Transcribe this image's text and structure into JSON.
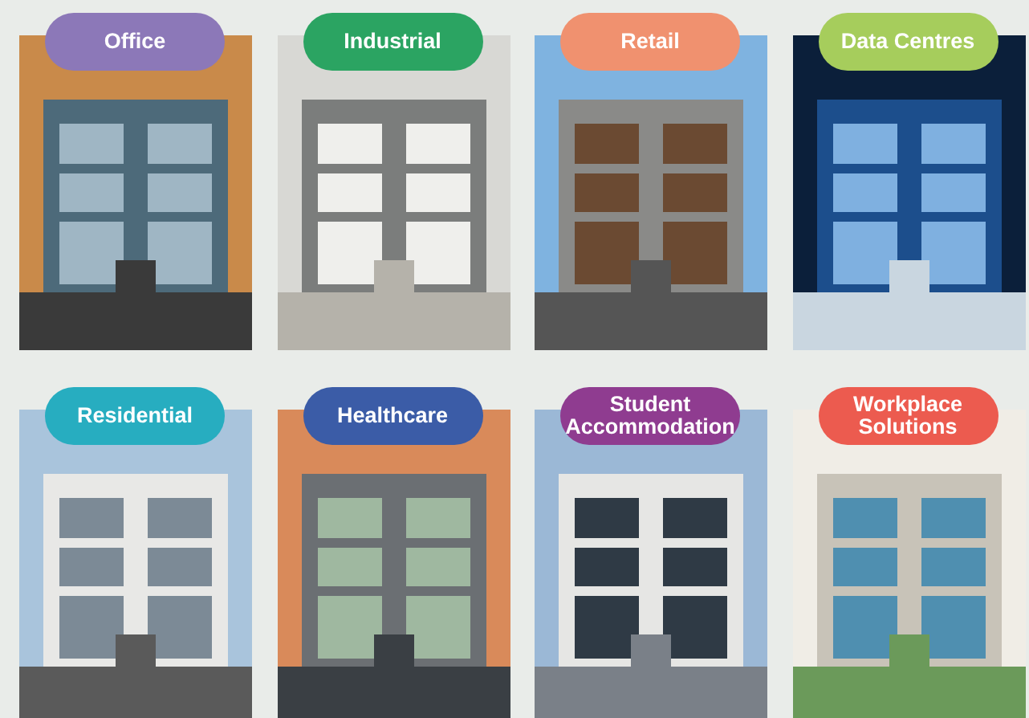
{
  "sectors": [
    {
      "label": "Office",
      "color": "#8c78b8"
    },
    {
      "label": "Industrial",
      "color": "#2ba462"
    },
    {
      "label": "Retail",
      "color": "#f0916f"
    },
    {
      "label": "Data Centres",
      "color": "#a6cd5c"
    },
    {
      "label": "Residential",
      "color": "#27adc0"
    },
    {
      "label": "Healthcare",
      "color": "#3b5ca7"
    },
    {
      "label": "Student Accommodation",
      "color": "#8f3c90"
    },
    {
      "label": "Workplace Solutions",
      "color": "#ec5b4f"
    }
  ]
}
